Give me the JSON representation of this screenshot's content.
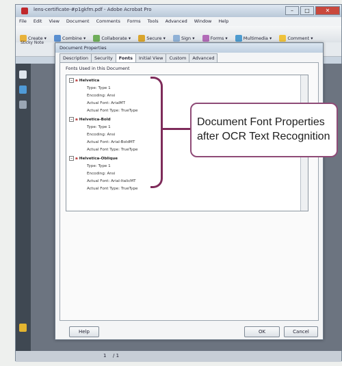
{
  "window": {
    "title": "lens-certificate-#p1gkfm.pdf - Adobe Acrobat Pro",
    "minimize": "–",
    "maximize": "□",
    "close": "✕"
  },
  "menu": [
    "File",
    "Edit",
    "View",
    "Document",
    "Comments",
    "Forms",
    "Tools",
    "Advanced",
    "Window",
    "Help"
  ],
  "toolbar": {
    "create": "Create ▾",
    "combine": "Combine ▾",
    "collaborate": "Collaborate ▾",
    "secure": "Secure ▾",
    "sign": "Sign ▾",
    "forms": "Forms ▾",
    "multimedia": "Multimedia ▾",
    "comment": "Comment ▾"
  },
  "nav": {
    "sticky": "Sticky Note"
  },
  "status": {
    "page": "1",
    "of": "/ 1"
  },
  "dialog": {
    "title": "Document Properties",
    "tabs": [
      "Description",
      "Security",
      "Fonts",
      "Initial View",
      "Custom",
      "Advanced"
    ],
    "active_tab": "Fonts",
    "fonts_label": "Fonts Used in this Document",
    "fonts": [
      {
        "name": "Helvetica",
        "type": "Type: Type 1",
        "encoding": "Encoding: Ansi",
        "actual": "Actual Font: ArialMT",
        "actual_type": "Actual Font Type: TrueType"
      },
      {
        "name": "Helvetica-Bold",
        "type": "Type: Type 1",
        "encoding": "Encoding: Ansi",
        "actual": "Actual Font: Arial-BoldMT",
        "actual_type": "Actual Font Type: TrueType"
      },
      {
        "name": "Helvetica-Oblique",
        "type": "Type: Type 1",
        "encoding": "Encoding: Ansi",
        "actual": "Actual Font: Arial-ItalicMT",
        "actual_type": "Actual Font Type: TrueType"
      }
    ],
    "help_button": "Help",
    "ok_button": "OK",
    "cancel_button": "Cancel"
  },
  "callout": {
    "line1": "Document Font Properties",
    "line2": "after OCR Text Recognition"
  },
  "colors": {
    "accent": "#7e2b5a",
    "font_icon": "#b01c1c"
  }
}
